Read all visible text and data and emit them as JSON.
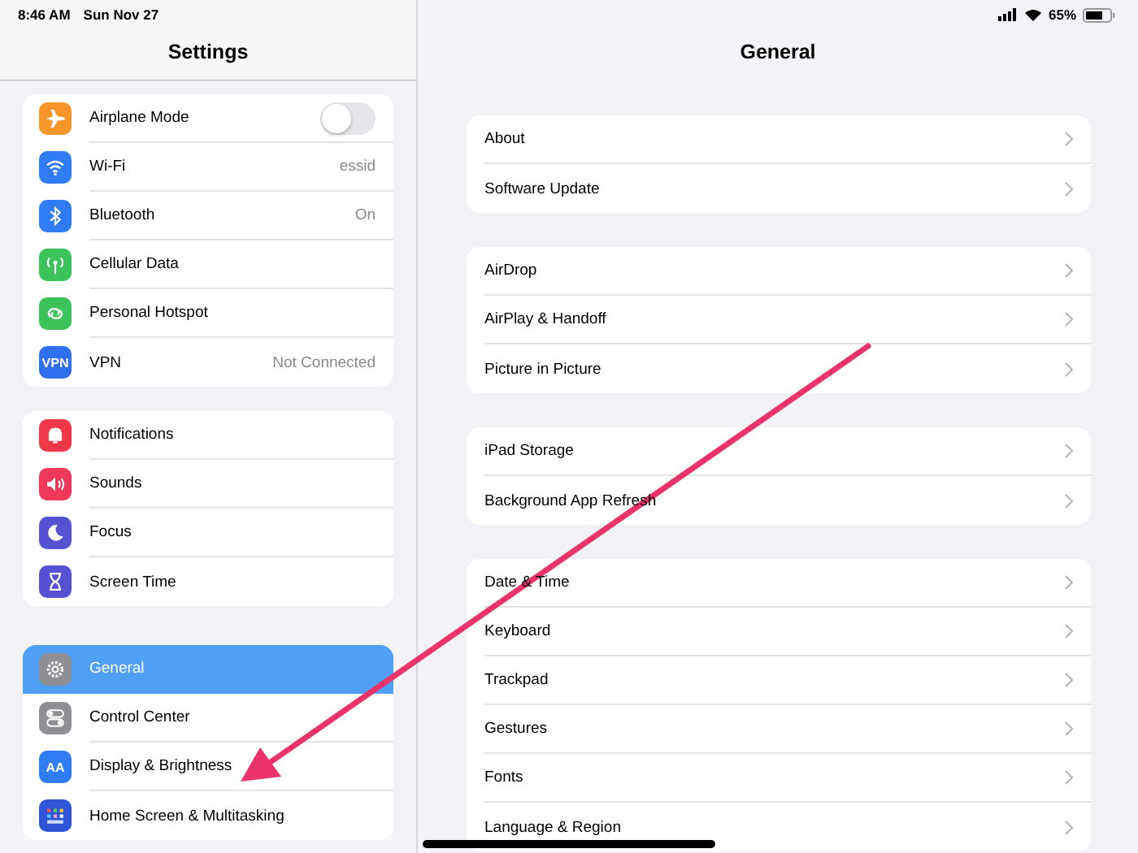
{
  "status_bar": {
    "time": "8:46 AM",
    "date": "Sun Nov 27",
    "battery": "65%"
  },
  "sidebar": {
    "title": "Settings",
    "groups": [
      {
        "items": [
          {
            "label": "Airplane Mode",
            "kind": "toggle",
            "on": false,
            "color": "#f7962a",
            "selected": false
          },
          {
            "label": "Wi-Fi",
            "kind": "value",
            "value": "essid",
            "color": "#2f7cf6",
            "selected": false
          },
          {
            "label": "Bluetooth",
            "kind": "value",
            "value": "On",
            "color": "#2f7cf6",
            "selected": false
          },
          {
            "label": "Cellular Data",
            "kind": "plain",
            "color": "#3cc35a",
            "selected": false
          },
          {
            "label": "Personal Hotspot",
            "kind": "plain",
            "color": "#3cc35a",
            "selected": false
          },
          {
            "label": "VPN",
            "kind": "value",
            "value": "Not Connected",
            "color": "#2f6ff0",
            "icon_text": "VPN",
            "selected": false
          }
        ]
      },
      {
        "items": [
          {
            "label": "Notifications",
            "kind": "plain",
            "color": "#f0384a",
            "selected": false
          },
          {
            "label": "Sounds",
            "kind": "plain",
            "color": "#f0385a",
            "selected": false
          },
          {
            "label": "Focus",
            "kind": "plain",
            "color": "#5552d4",
            "selected": false
          },
          {
            "label": "Screen Time",
            "kind": "plain",
            "color": "#5552d4",
            "selected": false
          }
        ]
      },
      {
        "items": [
          {
            "label": "General",
            "kind": "plain",
            "color": "#8e8e93",
            "selected": true
          },
          {
            "label": "Control Center",
            "kind": "plain",
            "color": "#8e8e93",
            "selected": false
          },
          {
            "label": "Display & Brightness",
            "kind": "plain",
            "color": "#2f7cf6",
            "icon_text": "AA",
            "selected": false
          },
          {
            "label": "Home Screen & Multitasking",
            "kind": "plain",
            "color": "#2e55d8",
            "selected": false
          }
        ]
      }
    ]
  },
  "detail": {
    "title": "General",
    "groups": [
      {
        "items": [
          "About",
          "Software Update"
        ]
      },
      {
        "items": [
          "AirDrop",
          "AirPlay & Handoff",
          "Picture in Picture"
        ]
      },
      {
        "items": [
          "iPad Storage",
          "Background App Refresh"
        ]
      },
      {
        "items": [
          "Date & Time",
          "Keyboard",
          "Trackpad",
          "Gestures",
          "Fonts",
          "Language & Region"
        ]
      }
    ]
  }
}
